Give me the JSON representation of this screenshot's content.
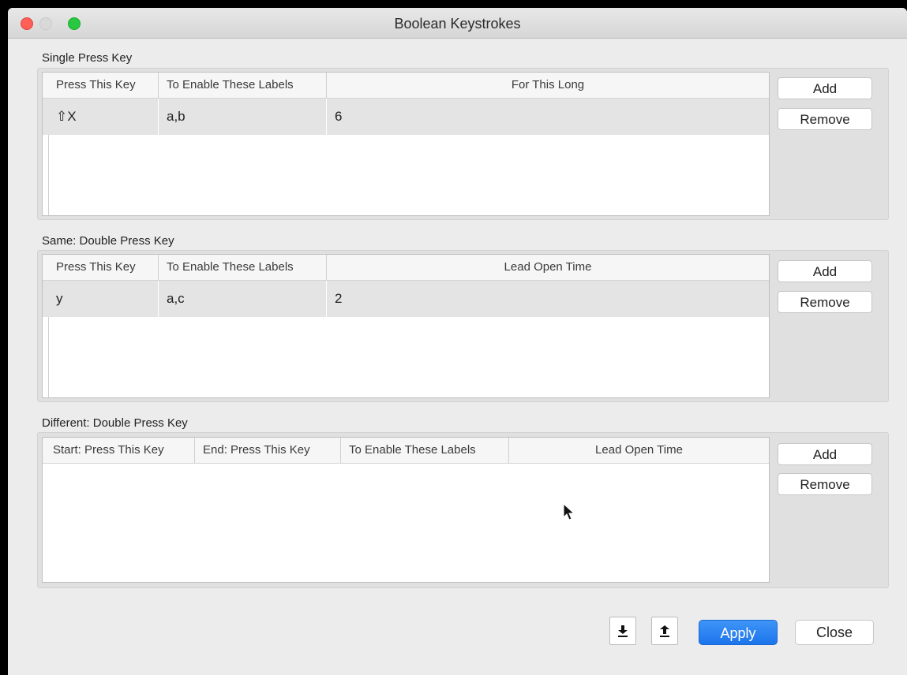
{
  "window": {
    "title": "Boolean Keystrokes"
  },
  "single": {
    "label": "Single Press Key",
    "headers": [
      "Press This Key",
      "To Enable These Labels",
      "For This Long"
    ],
    "row": {
      "key": "⇧X",
      "labels": "a,b",
      "value": "6"
    },
    "add": "Add",
    "remove": "Remove"
  },
  "same": {
    "label": "Same: Double Press Key",
    "headers": [
      "Press This Key",
      "To Enable These Labels",
      "Lead Open Time"
    ],
    "row": {
      "key": "y",
      "labels": "a,c",
      "value": "2"
    },
    "add": "Add",
    "remove": "Remove"
  },
  "different": {
    "label": "Different: Double Press Key",
    "headers": [
      "Start: Press This Key",
      "End: Press This Key",
      "To Enable These Labels",
      "Lead Open Time"
    ],
    "add": "Add",
    "remove": "Remove"
  },
  "footer": {
    "import_icon": "download-icon",
    "export_icon": "upload-icon",
    "apply": "Apply",
    "close": "Close"
  },
  "colors": {
    "accent": "#1c74ec",
    "close_light": "#fe5f57",
    "max_light": "#28c840"
  }
}
